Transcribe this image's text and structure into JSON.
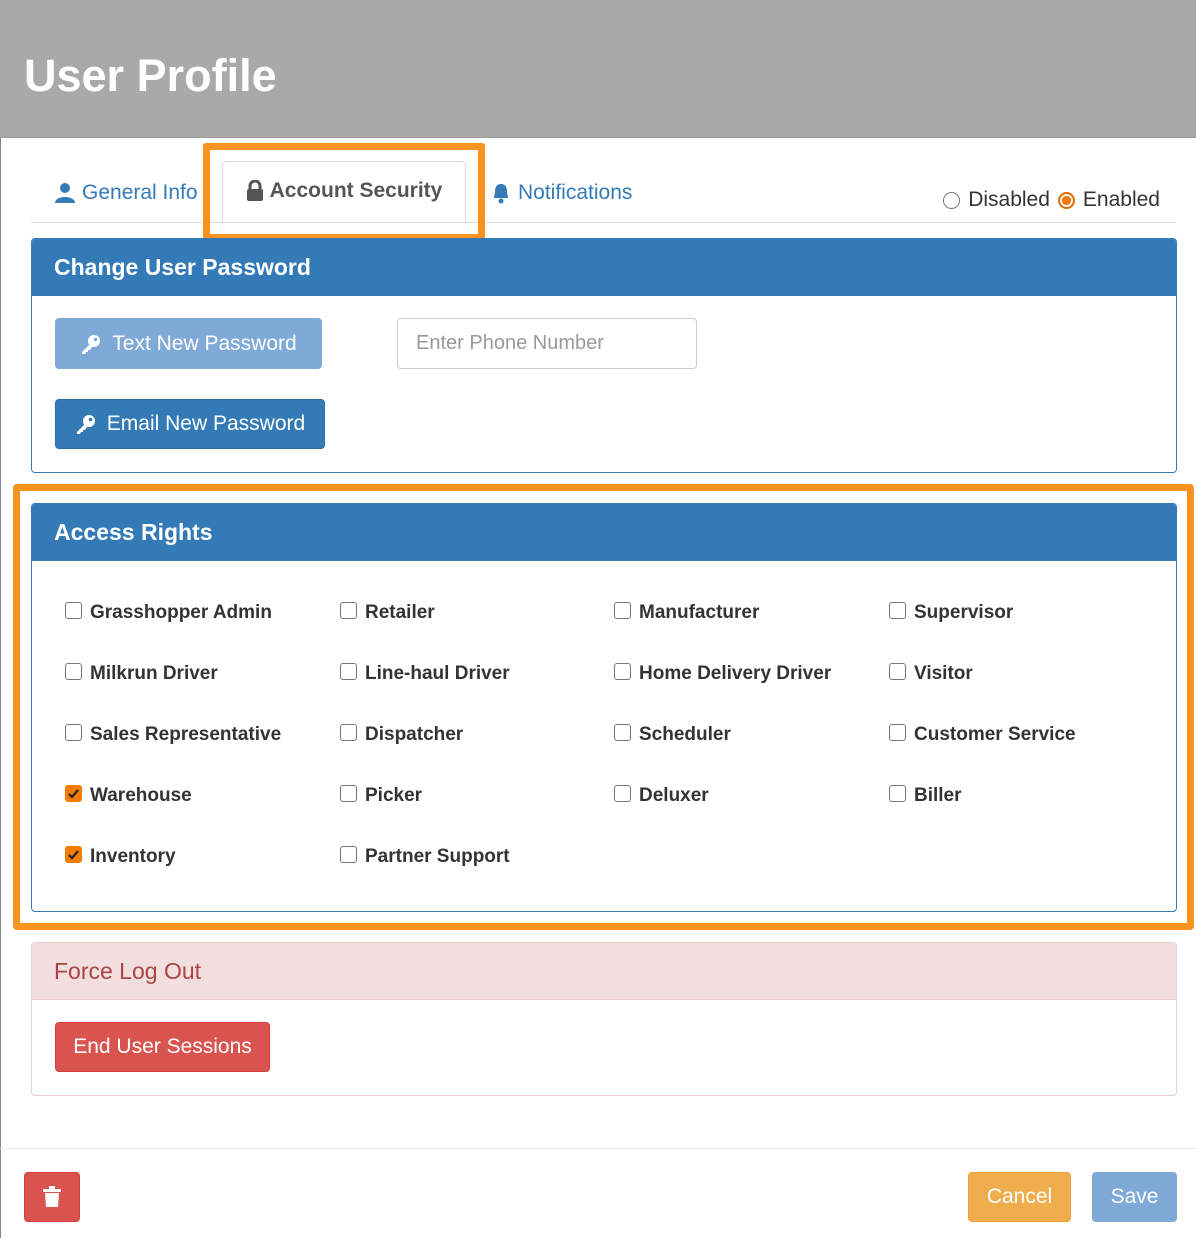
{
  "header": {
    "title": "User Profile"
  },
  "tabs": [
    {
      "label": "General Info",
      "icon": "user-icon"
    },
    {
      "label": "Account Security",
      "icon": "lock-icon",
      "active": true
    },
    {
      "label": "Notifications",
      "icon": "bell-icon"
    }
  ],
  "status": {
    "options": [
      "Disabled",
      "Enabled"
    ],
    "selected": "Enabled"
  },
  "password_panel": {
    "title": "Change User Password",
    "text_button": "Text New Password",
    "email_button": "Email New Password",
    "phone_placeholder": "Enter Phone Number",
    "button_icon": "key-icon"
  },
  "access_panel": {
    "title": "Access Rights",
    "rights": [
      {
        "label": "Grasshopper Admin",
        "checked": false
      },
      {
        "label": "Retailer",
        "checked": false
      },
      {
        "label": "Manufacturer",
        "checked": false
      },
      {
        "label": "Supervisor",
        "checked": false
      },
      {
        "label": "Milkrun Driver",
        "checked": false
      },
      {
        "label": "Line-haul Driver",
        "checked": false
      },
      {
        "label": "Home Delivery Driver",
        "checked": false
      },
      {
        "label": "Visitor",
        "checked": false
      },
      {
        "label": "Sales Representative",
        "checked": false
      },
      {
        "label": "Dispatcher",
        "checked": false
      },
      {
        "label": "Scheduler",
        "checked": false
      },
      {
        "label": "Customer Service",
        "checked": false
      },
      {
        "label": "Warehouse",
        "checked": true
      },
      {
        "label": "Picker",
        "checked": false
      },
      {
        "label": "Deluxer",
        "checked": false
      },
      {
        "label": "Biller",
        "checked": false
      },
      {
        "label": "Inventory",
        "checked": true
      },
      {
        "label": "Partner Support",
        "checked": false
      }
    ]
  },
  "logout_panel": {
    "title": "Force Log Out",
    "button": "End User Sessions"
  },
  "footer": {
    "delete_icon": "trash-icon",
    "cancel": "Cancel",
    "save": "Save"
  },
  "colors": {
    "primary": "#337ab7",
    "highlight": "#f7931e",
    "danger": "#d9534f",
    "warning": "#f0ad4e",
    "header": "#a9a9a9",
    "checked": "#f57c00"
  }
}
